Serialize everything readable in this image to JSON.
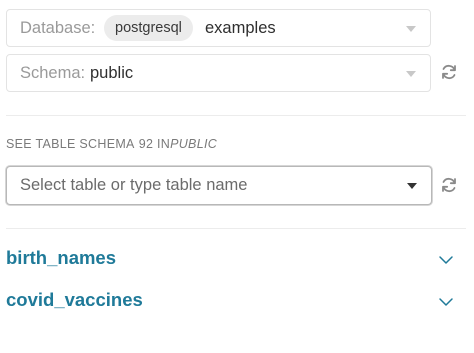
{
  "database_select": {
    "label": "Database:",
    "pill": "postgresql",
    "value": "examples"
  },
  "schema_select": {
    "label": "Schema:",
    "value": "public"
  },
  "section": {
    "heading": "SEE TABLE SCHEMA",
    "count": "92",
    "in_word": "IN",
    "schema_name": "PUBLIC"
  },
  "table_select": {
    "placeholder": "Select table or type table name"
  },
  "tables": [
    {
      "name": "birth_names"
    },
    {
      "name": "covid_vaccines"
    }
  ],
  "icons": {
    "caret": "chevron-down-icon",
    "refresh": "refresh-icon",
    "expand": "chevron-down-icon"
  },
  "colors": {
    "accent": "#1f7a99",
    "pill_bg": "#ececec"
  }
}
